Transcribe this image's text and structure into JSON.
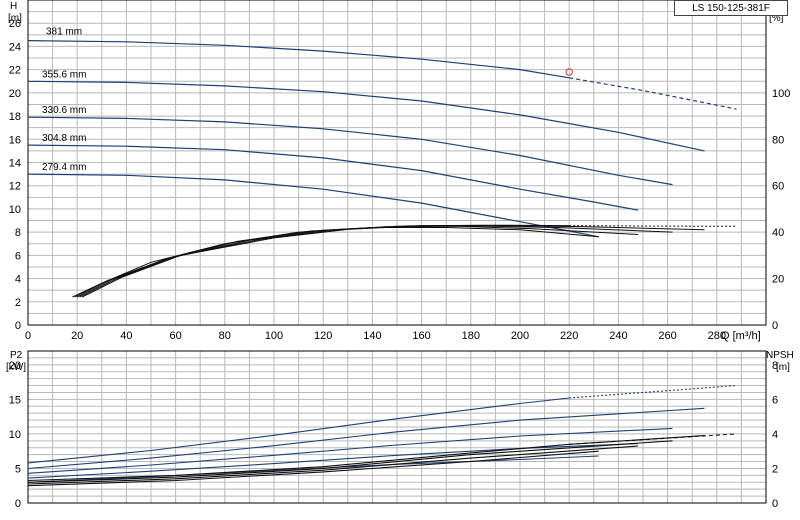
{
  "title": "LS 150-125-381F",
  "chart_data": [
    {
      "type": "line",
      "name": "head-efficiency",
      "xlabel": "Q [m³/h]",
      "xlim": [
        0,
        300
      ],
      "xticks": [
        0,
        20,
        40,
        60,
        80,
        100,
        120,
        140,
        160,
        180,
        200,
        220,
        240,
        260,
        280
      ],
      "ylabel_left": [
        "H",
        "[m]"
      ],
      "ylim_left": [
        0,
        28
      ],
      "yticks_left": [
        0,
        2,
        4,
        6,
        8,
        10,
        12,
        14,
        16,
        18,
        20,
        22,
        24,
        26
      ],
      "ylabel_right": [
        "eta",
        "[%]"
      ],
      "ylim_right": [
        0,
        140
      ],
      "yticks_right": [
        0,
        20,
        40,
        60,
        80,
        100
      ],
      "grid": true,
      "head_series": [
        {
          "name": "381 mm",
          "x": [
            0,
            40,
            80,
            120,
            160,
            200,
            220
          ],
          "y": [
            24.5,
            24.4,
            24.1,
            23.6,
            22.9,
            22.0,
            21.3
          ],
          "dashed_x": [
            220,
            250,
            288
          ],
          "dashed_y": [
            21.3,
            20.2,
            18.6
          ]
        },
        {
          "name": "355.6 mm",
          "x": [
            0,
            40,
            80,
            120,
            160,
            200,
            240,
            275
          ],
          "y": [
            21.0,
            20.9,
            20.6,
            20.1,
            19.3,
            18.1,
            16.6,
            15.0
          ]
        },
        {
          "name": "330.6 mm",
          "x": [
            0,
            40,
            80,
            120,
            160,
            200,
            240,
            262
          ],
          "y": [
            17.9,
            17.8,
            17.5,
            16.9,
            16.0,
            14.6,
            12.9,
            12.1
          ]
        },
        {
          "name": "304.8 mm",
          "x": [
            0,
            40,
            80,
            120,
            160,
            200,
            230,
            248
          ],
          "y": [
            15.5,
            15.4,
            15.1,
            14.4,
            13.3,
            11.7,
            10.6,
            9.9
          ]
        },
        {
          "name": "279.4 mm",
          "x": [
            0,
            40,
            80,
            120,
            160,
            200,
            220,
            232
          ],
          "y": [
            13.0,
            12.9,
            12.5,
            11.7,
            10.5,
            8.9,
            8.1,
            7.6
          ]
        }
      ],
      "efficiency_series": [
        {
          "x": [
            18,
            30,
            50,
            80,
            110,
            140,
            170,
            200,
            232
          ],
          "y": [
            12,
            18,
            27,
            35,
            40,
            42,
            42,
            41,
            38
          ]
        },
        {
          "x": [
            19,
            32,
            55,
            85,
            115,
            145,
            175,
            205,
            248
          ],
          "y": [
            12,
            19,
            28,
            36,
            40.5,
            42.3,
            42.5,
            41.5,
            39
          ]
        },
        {
          "x": [
            20,
            34,
            58,
            90,
            120,
            150,
            180,
            215,
            262
          ],
          "y": [
            12,
            19.5,
            29,
            36.5,
            40.8,
            42.5,
            42.7,
            42,
            40
          ]
        },
        {
          "x": [
            21,
            36,
            60,
            95,
            125,
            155,
            185,
            225,
            275
          ],
          "y": [
            12,
            20,
            29.5,
            37,
            41,
            42.7,
            42.9,
            42.4,
            41
          ]
        },
        {
          "x": [
            22,
            38,
            62,
            100,
            130,
            160,
            190,
            220
          ],
          "y": [
            12,
            20.5,
            30,
            37.5,
            41.2,
            42.8,
            43,
            42.8
          ],
          "dashed_x": [
            220,
            255,
            288
          ],
          "dashed_y": [
            42.8,
            42.6,
            42.5
          ]
        }
      ],
      "operating_point": {
        "x": 220,
        "y": 21.8
      }
    },
    {
      "type": "line",
      "name": "power-npsh",
      "xlim": [
        0,
        300
      ],
      "ylabel_left": [
        "P2",
        "[kW]"
      ],
      "ylim_left": [
        0,
        22
      ],
      "yticks_left": [
        0,
        5,
        10,
        15,
        20
      ],
      "ylabel_right": [
        "NPSH",
        "[m]"
      ],
      "ylim_right": [
        0,
        8.8
      ],
      "yticks_right": [
        0,
        2,
        4,
        6,
        8
      ],
      "grid": true,
      "power_series": [
        {
          "x": [
            0,
            50,
            100,
            150,
            200,
            220
          ],
          "y": [
            5.8,
            7.6,
            9.8,
            12.2,
            14.4,
            15.2
          ],
          "dashed_x": [
            220,
            288
          ],
          "dashed_y": [
            15.2,
            17.0
          ]
        },
        {
          "x": [
            0,
            50,
            100,
            150,
            200,
            275
          ],
          "y": [
            5.0,
            6.5,
            8.3,
            10.3,
            12.0,
            13.7
          ]
        },
        {
          "x": [
            0,
            50,
            100,
            150,
            200,
            262
          ],
          "y": [
            4.3,
            5.5,
            6.9,
            8.4,
            9.7,
            10.8
          ]
        },
        {
          "x": [
            0,
            50,
            100,
            150,
            200,
            248
          ],
          "y": [
            3.6,
            4.6,
            5.7,
            6.9,
            7.9,
            8.6
          ]
        },
        {
          "x": [
            0,
            50,
            100,
            150,
            200,
            232
          ],
          "y": [
            3.0,
            3.8,
            4.7,
            5.6,
            6.3,
            6.8
          ]
        }
      ],
      "npsh_series": [
        {
          "x": [
            0,
            60,
            120,
            180,
            232
          ],
          "y": [
            1.0,
            1.3,
            1.8,
            2.4,
            3.0
          ]
        },
        {
          "x": [
            0,
            60,
            120,
            180,
            248
          ],
          "y": [
            1.1,
            1.4,
            1.9,
            2.6,
            3.3
          ]
        },
        {
          "x": [
            0,
            60,
            120,
            180,
            262
          ],
          "y": [
            1.2,
            1.5,
            2.0,
            2.8,
            3.6
          ]
        },
        {
          "x": [
            0,
            60,
            120,
            180,
            220,
            275
          ],
          "y": [
            1.3,
            1.6,
            2.1,
            2.9,
            3.4,
            3.9
          ],
          "dashed_x": [
            220,
            288
          ],
          "dashed_y": [
            3.4,
            4.0
          ]
        }
      ]
    }
  ]
}
